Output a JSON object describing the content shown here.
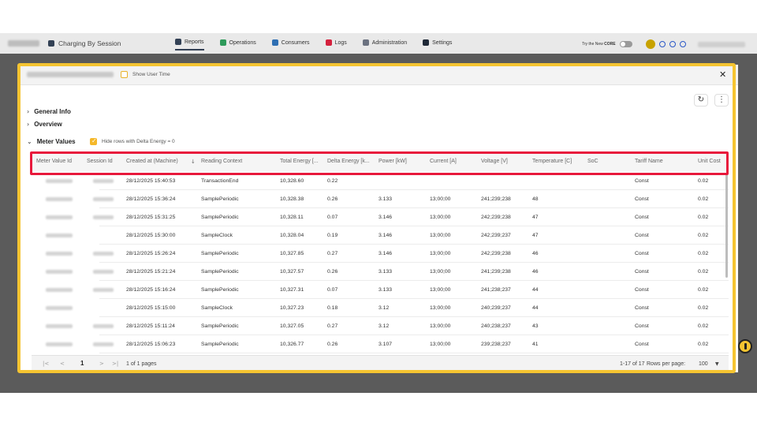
{
  "nav": {
    "page_title": "Charging By Session",
    "tabs": [
      {
        "label": "Reports",
        "color": "#334155"
      },
      {
        "label": "Operations",
        "color": "#2e9a5a"
      },
      {
        "label": "Consumers",
        "color": "#2f6fb3"
      },
      {
        "label": "Logs",
        "color": "#d4213d"
      },
      {
        "label": "Administration",
        "color": "#6b7280"
      },
      {
        "label": "Settings",
        "color": "#1f2937"
      }
    ],
    "try_new_prefix": "Try the New",
    "try_new_brand": "CORE"
  },
  "modal": {
    "show_user_time_label": "Show User Time",
    "close_glyph": "✕",
    "refresh_glyph": "↻",
    "more_glyph": "⋮",
    "sections": {
      "general_info": "General Info",
      "overview": "Overview",
      "meter_values": "Meter Values"
    },
    "hide_rows_label": "Hide rows with Delta Energy = 0"
  },
  "table": {
    "columns": [
      "Meter Value Id",
      "Session Id",
      "Created at (Machine)",
      "Reading Context",
      "Total Energy [...",
      "Delta Energy [k...",
      "Power [kW]",
      "Current [A]",
      "Voltage [V]",
      "Temperature [C]",
      "SoC",
      "Tariff Name",
      "Unit Cost"
    ],
    "sort_glyph": "↓",
    "rows": [
      {
        "created": "28/12/2025 15:40:53",
        "context": "TransactionEnd",
        "total": "10,328.60",
        "delta": "0.22",
        "power": "",
        "current": "",
        "voltage": "",
        "temp": "",
        "soc": "",
        "tariff": "Const",
        "cost": "0.02"
      },
      {
        "created": "28/12/2025 15:36:24",
        "context": "SamplePeriodic",
        "total": "10,328.38",
        "delta": "0.26",
        "power": "3.133",
        "current": "13;00;00",
        "voltage": "241;239;238",
        "temp": "48",
        "soc": "",
        "tariff": "Const",
        "cost": "0.02"
      },
      {
        "created": "28/12/2025 15:31:25",
        "context": "SamplePeriodic",
        "total": "10,328.11",
        "delta": "0.07",
        "power": "3.146",
        "current": "13;00;00",
        "voltage": "242;239;238",
        "temp": "47",
        "soc": "",
        "tariff": "Const",
        "cost": "0.02"
      },
      {
        "created": "28/12/2025 15:30:00",
        "context": "SampleClock",
        "total": "10,328.04",
        "delta": "0.19",
        "power": "3.146",
        "current": "13;00;00",
        "voltage": "242;239;237",
        "temp": "47",
        "soc": "",
        "tariff": "Const",
        "cost": "0.02"
      },
      {
        "created": "28/12/2025 15:26:24",
        "context": "SamplePeriodic",
        "total": "10,327.85",
        "delta": "0.27",
        "power": "3.146",
        "current": "13;00;00",
        "voltage": "242;239;238",
        "temp": "46",
        "soc": "",
        "tariff": "Const",
        "cost": "0.02"
      },
      {
        "created": "28/12/2025 15:21:24",
        "context": "SamplePeriodic",
        "total": "10,327.57",
        "delta": "0.26",
        "power": "3.133",
        "current": "13;00;00",
        "voltage": "241;239;238",
        "temp": "46",
        "soc": "",
        "tariff": "Const",
        "cost": "0.02"
      },
      {
        "created": "28/12/2025 15:16:24",
        "context": "SamplePeriodic",
        "total": "10,327.31",
        "delta": "0.07",
        "power": "3.133",
        "current": "13;00;00",
        "voltage": "241;238;237",
        "temp": "44",
        "soc": "",
        "tariff": "Const",
        "cost": "0.02"
      },
      {
        "created": "28/12/2025 15:15:00",
        "context": "SampleClock",
        "total": "10,327.23",
        "delta": "0.18",
        "power": "3.12",
        "current": "13;00;00",
        "voltage": "240;239;237",
        "temp": "44",
        "soc": "",
        "tariff": "Const",
        "cost": "0.02"
      },
      {
        "created": "28/12/2025 15:11:24",
        "context": "SamplePeriodic",
        "total": "10,327.05",
        "delta": "0.27",
        "power": "3.12",
        "current": "13;00;00",
        "voltage": "240;238;237",
        "temp": "43",
        "soc": "",
        "tariff": "Const",
        "cost": "0.02"
      },
      {
        "created": "28/12/2025 15:06:23",
        "context": "SamplePeriodic",
        "total": "10,326.77",
        "delta": "0.26",
        "power": "3.107",
        "current": "13;00;00",
        "voltage": "239;238;237",
        "temp": "41",
        "soc": "",
        "tariff": "Const",
        "cost": "0.02"
      }
    ]
  },
  "footer": {
    "first_glyph": "|<",
    "prev_glyph": "<",
    "current_page": "1",
    "next_glyph": ">",
    "last_glyph": ">|",
    "page_info": "1 of 1 pages",
    "range_info": "1-17 of 17",
    "rows_per_page_label": "Rows per page:",
    "rows_per_page_value": "100",
    "dropdown_glyph": "▼"
  },
  "colors": {
    "highlight_frame": "#f5c431",
    "header_highlight": "#e8193c",
    "checkbox_accent": "#f5b82a"
  }
}
